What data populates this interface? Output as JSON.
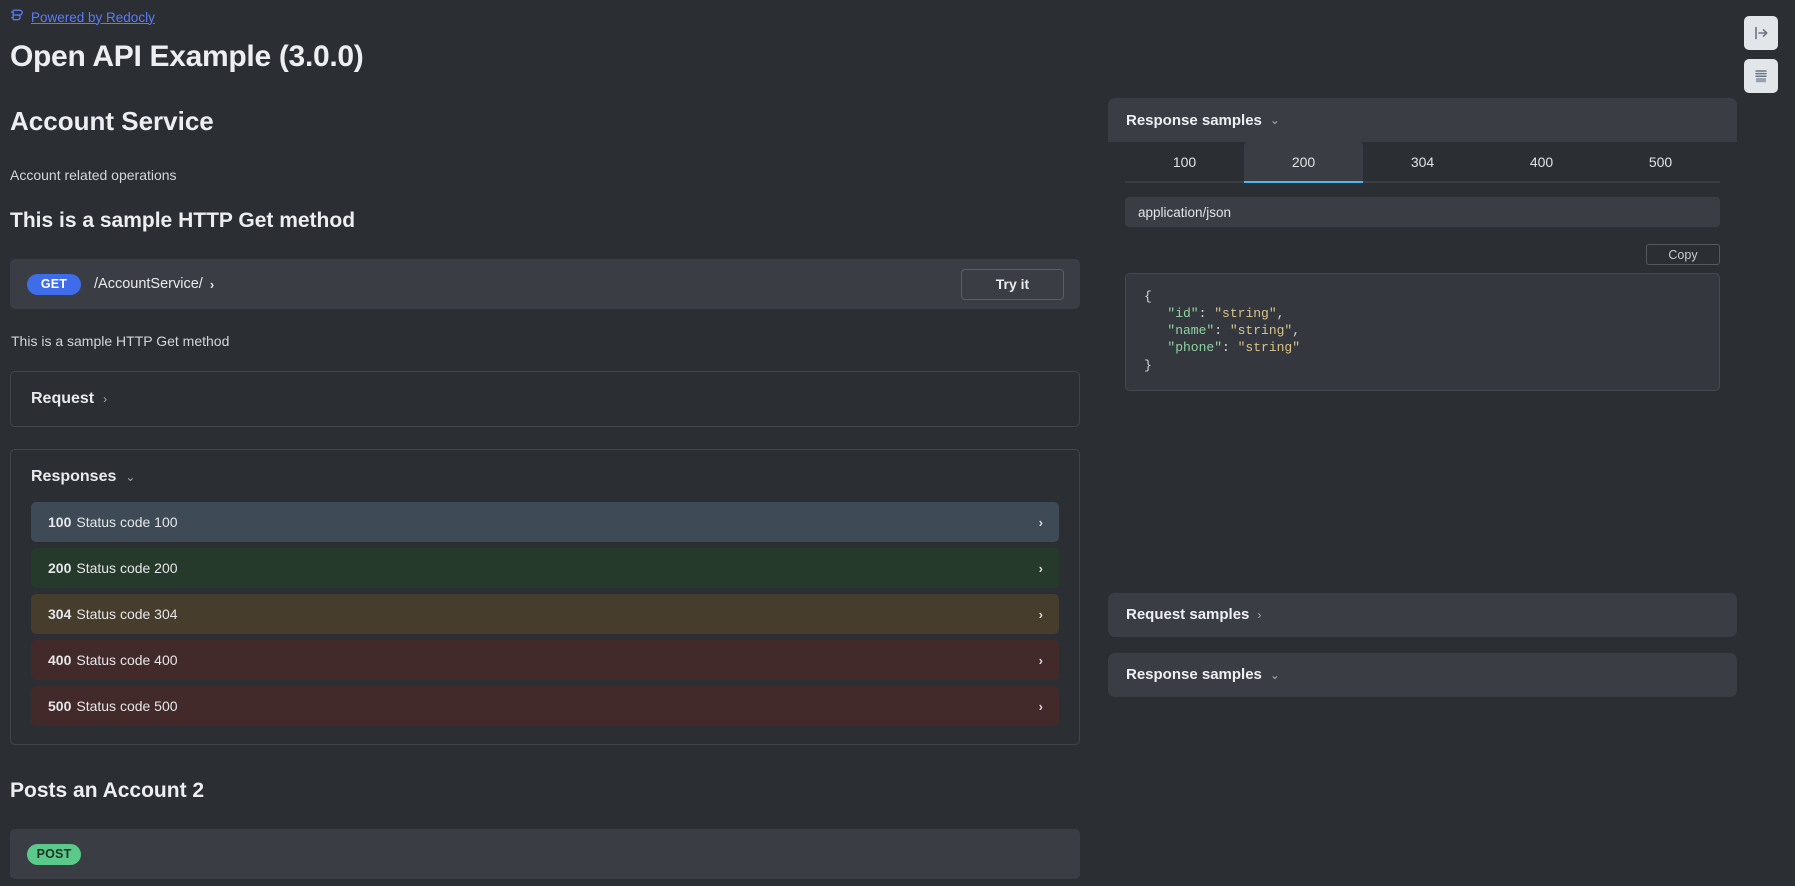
{
  "branding": {
    "logo_icon": "redocly-logo-icon",
    "link_label": "Powered by Redocly"
  },
  "header": {
    "api_title": "Open API Example (3.0.0)"
  },
  "corner_tools": [
    {
      "name": "expand-panel-button",
      "icon": "arrow-from-line-right-icon"
    },
    {
      "name": "layout-panel-button",
      "icon": "panel-layout-icon"
    }
  ],
  "tag": {
    "title": "Account Service",
    "description": "Account related operations"
  },
  "operation": {
    "title": "This is a sample HTTP Get method",
    "method": "GET",
    "path": "/AccountService/",
    "path_chevron": "›",
    "try_it_label": "Try it",
    "description": "This is a sample HTTP Get method",
    "request_section": {
      "label": "Request",
      "chevron": "›"
    },
    "responses_section": {
      "label": "Responses",
      "chevron": "⌄",
      "rows": [
        {
          "code": "100",
          "text": "Status code 100",
          "bg": "#3e4a55",
          "arrow": "›"
        },
        {
          "code": "200",
          "text": "Status code 200",
          "bg": "#263a2b",
          "arrow": "›"
        },
        {
          "code": "304",
          "text": "Status code 304",
          "bg": "#463d2c",
          "arrow": "›"
        },
        {
          "code": "400",
          "text": "Status code 400",
          "bg": "#432a2a",
          "arrow": "›"
        },
        {
          "code": "500",
          "text": "Status code 500",
          "bg": "#432a2a",
          "arrow": "›"
        }
      ]
    }
  },
  "next_operation": {
    "title": "Posts an Account 2",
    "method": "POST"
  },
  "response_samples": {
    "title": "Response samples",
    "chevron": "⌄",
    "tabs": [
      {
        "label": "100",
        "active": false
      },
      {
        "label": "200",
        "active": true
      },
      {
        "label": "304",
        "active": false
      },
      {
        "label": "400",
        "active": false
      },
      {
        "label": "500",
        "active": false
      }
    ],
    "mime_type": "application/json",
    "copy_label": "Copy",
    "code_lines": [
      {
        "indent": 0,
        "parts": [
          {
            "t": "punc",
            "v": "{"
          }
        ]
      },
      {
        "indent": 1,
        "parts": [
          {
            "t": "key",
            "v": "\"id\""
          },
          {
            "t": "punc",
            "v": ": "
          },
          {
            "t": "str",
            "v": "\"string\""
          },
          {
            "t": "punc",
            "v": ","
          }
        ]
      },
      {
        "indent": 1,
        "parts": [
          {
            "t": "key",
            "v": "\"name\""
          },
          {
            "t": "punc",
            "v": ": "
          },
          {
            "t": "str",
            "v": "\"string\""
          },
          {
            "t": "punc",
            "v": ","
          }
        ]
      },
      {
        "indent": 1,
        "parts": [
          {
            "t": "key",
            "v": "\"phone\""
          },
          {
            "t": "punc",
            "v": ": "
          },
          {
            "t": "str",
            "v": "\"string\""
          }
        ]
      },
      {
        "indent": 0,
        "parts": [
          {
            "t": "punc",
            "v": "}"
          }
        ]
      }
    ]
  },
  "request_samples": {
    "title": "Request samples",
    "chevron": "›"
  },
  "response_samples_next": {
    "title": "Response samples",
    "chevron": "⌄"
  },
  "colors": {
    "page_bg": "#2b2e33",
    "panel_bg": "#3a3d44",
    "accent_blue": "#4db6f0",
    "get_badge": "#3f6ce8",
    "post_badge": "#5bc98a",
    "link": "#5b7cf7"
  }
}
